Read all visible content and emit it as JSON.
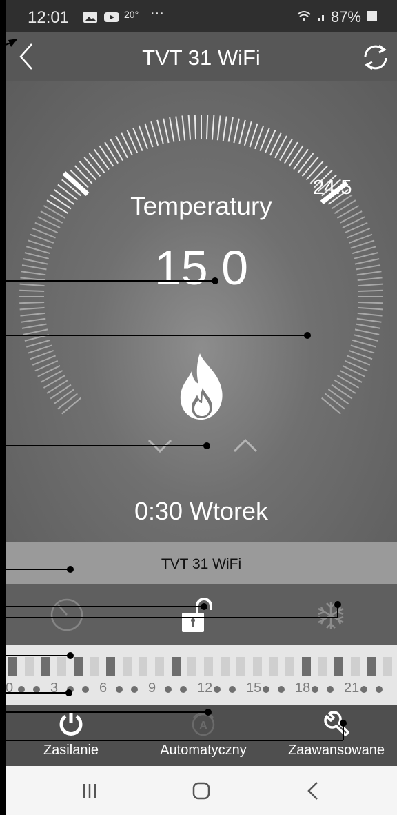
{
  "status_bar": {
    "time": "12:01",
    "temperature_badge": "20°",
    "more": "···",
    "battery_percent": "87%"
  },
  "header": {
    "title": "TVT 31 WiFi",
    "back_icon": "chevron-left-icon",
    "refresh_icon": "refresh-icon"
  },
  "thermostat": {
    "setpoint": "24.5",
    "label": "Temperatury",
    "current_value": "15.0",
    "mode_icon": "flame-icon",
    "clock": "0:30 Wtorek"
  },
  "device_bar": {
    "name": "TVT 31 WiFi"
  },
  "schedule": {
    "hour_labels": [
      "0",
      "3",
      "6",
      "9",
      "12",
      "15",
      "18",
      "21"
    ],
    "slot_states": [
      "dark",
      "light",
      "dark",
      "light",
      "dark",
      "light",
      "dark",
      "light",
      "dark",
      "light",
      "dark",
      "light",
      "dark",
      "light",
      "dark",
      "light",
      "dark",
      "light",
      "dark",
      "light",
      "dark",
      "light",
      "dark",
      "light",
      "dark",
      "light",
      "dark",
      "light",
      "dark",
      "light",
      "dark",
      "light",
      "dark",
      "light",
      "dark",
      "light",
      "dark",
      "light",
      "dark",
      "light",
      "dark",
      "light",
      "dark",
      "light",
      "dark",
      "light",
      "dark",
      "light",
      "dark",
      "light",
      "dark",
      "light",
      "dark",
      "light",
      "dark",
      "light",
      "dark",
      "light",
      "dark",
      "light",
      "dark",
      "light",
      "dark",
      "light",
      "dark",
      "light",
      "dark",
      "light",
      "dark",
      "light",
      "dark",
      "light"
    ],
    "colors": {
      "active": "#6e6e6e",
      "inactive": "#cfcfcf"
    }
  },
  "bottom_tabs": [
    {
      "label": "Zasilanie",
      "icon": "power-icon"
    },
    {
      "label": "Automatyczny",
      "icon": "auto-mode-icon"
    },
    {
      "label": "Zaawansowane",
      "icon": "wrench-icon"
    }
  ],
  "colors": {
    "accent": "#ffffff",
    "header_bg": "#575757",
    "dial_bg": "#707070",
    "device_bar_bg": "#9a9a9a"
  }
}
